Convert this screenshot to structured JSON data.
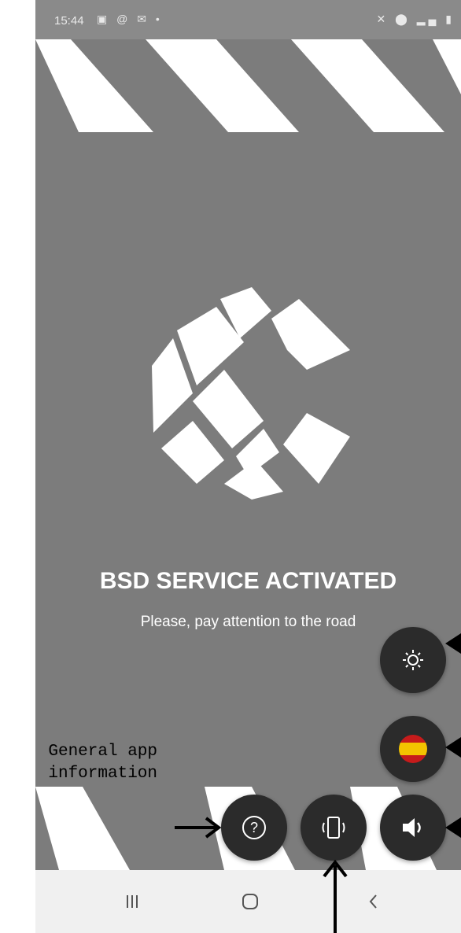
{
  "status_bar": {
    "time": "15:44",
    "left_icons": [
      "gallery-icon",
      "at-icon",
      "mail-icon",
      "dot-icon"
    ],
    "right_icons": [
      "mute-icon",
      "location-icon",
      "signal-icon",
      "battery-icon"
    ]
  },
  "main": {
    "title": "BSD SERVICE ACTIVATED",
    "subtitle": "Please, pay attention to the road"
  },
  "fab_buttons": [
    {
      "name": "brightness-button",
      "icon": "sun-icon"
    },
    {
      "name": "language-button",
      "icon": "spain-flag-icon"
    },
    {
      "name": "sound-button",
      "icon": "speaker-icon"
    },
    {
      "name": "vibration-button",
      "icon": "vibrate-icon"
    },
    {
      "name": "info-button",
      "icon": "question-icon"
    }
  ],
  "annotation": {
    "info_label": "General app\ninformation"
  },
  "nav_bar": {
    "items": [
      "recents-icon",
      "home-icon",
      "back-icon"
    ]
  },
  "colors": {
    "background": "#7c7c7c",
    "stripe": "#ffffff",
    "fab": "#2b2b2b",
    "flag_red": "#c61b1b",
    "flag_yellow": "#f3c300",
    "navbar": "#f0f0f0"
  }
}
